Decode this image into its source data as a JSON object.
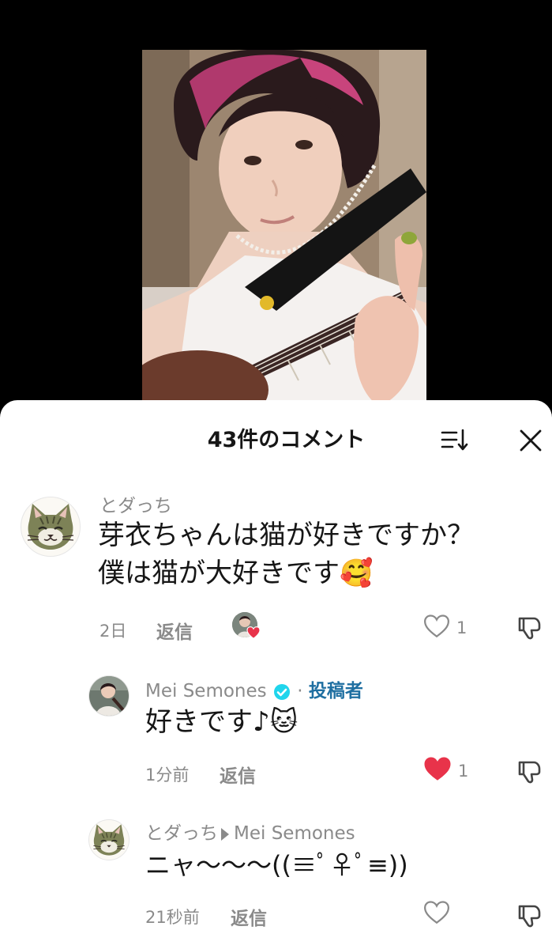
{
  "video": {
    "accent_colors": [
      "#c23a78",
      "#1a1a1a",
      "#e9e3dd"
    ]
  },
  "sheet": {
    "title": "43件のコメント",
    "icons": {
      "sort": "sort-icon",
      "close": "close-icon"
    }
  },
  "comments": [
    {
      "username": "とダっち",
      "text_line1": "芽衣ちゃんは猫が好きですか？",
      "text_line2": "僕は猫が大好きです🥰",
      "time": "2日",
      "reply_label": "返信",
      "like_count": "1",
      "liked_by_creator": true,
      "liked": false
    },
    {
      "username": "Mei Semones",
      "separator": "·",
      "op_label": "投稿者",
      "verified": true,
      "text": "好きです♪🐱",
      "time": "1分前",
      "reply_label": "返信",
      "like_count": "1",
      "liked": true,
      "like_color": "#e8334a"
    },
    {
      "username": "とダっち",
      "reply_to": "Mei Semones",
      "text": "ニャ〜〜〜((≡ﾟ♀ﾟ≡))",
      "time": "21秒前",
      "reply_label": "返信",
      "like_count": "",
      "liked": false
    }
  ]
}
